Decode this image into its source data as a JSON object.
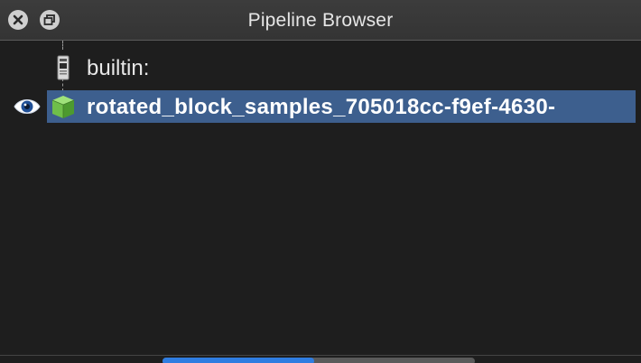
{
  "window": {
    "title": "Pipeline Browser",
    "close_icon": "close-icon",
    "float_icon": "undock-icon"
  },
  "pipeline": {
    "items": [
      {
        "label": "builtin:",
        "icon": "server-icon",
        "selected": false,
        "visible_toggle": false
      },
      {
        "label": "rotated_block_samples_705018cc-f9ef-4630-",
        "icon": "cube-icon",
        "selected": true,
        "visible_toggle": true
      }
    ]
  },
  "colors": {
    "background": "#1e1e1e",
    "selection": "#3d5f8e",
    "scroll_thumb": "#2f7de1",
    "cube_green": "#6fbf4a"
  }
}
